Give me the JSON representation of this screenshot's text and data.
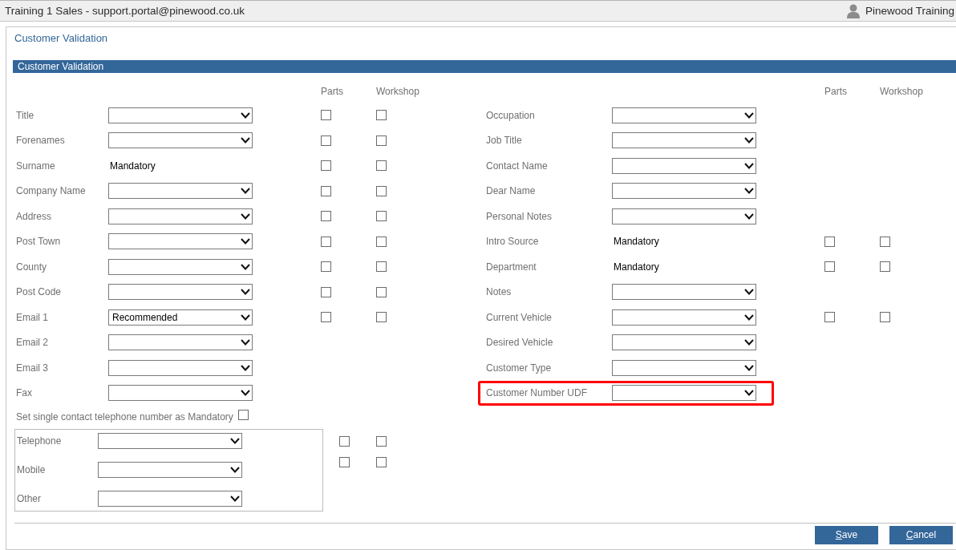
{
  "window": {
    "title": "Training 1 Sales - support.portal@pinewood.co.uk",
    "user": "Pinewood Training"
  },
  "page_title": "Customer Validation",
  "section": {
    "title": "Customer Validation",
    "left": {
      "column_headers": [
        "Parts",
        "Workshop"
      ],
      "rows": [
        {
          "label": "Title",
          "kind": "dropdown",
          "highlighted": false,
          "flags": [
            {
              "checked": false
            },
            {
              "checked": false
            }
          ]
        },
        {
          "label": "Forenames",
          "kind": "dropdown",
          "highlighted": false,
          "flags": [
            {
              "checked": false
            },
            {
              "checked": false
            }
          ]
        },
        {
          "label": "Surname",
          "kind": "fixed",
          "value": "Mandatory",
          "highlighted": false,
          "flags": [
            {
              "checked": false
            },
            {
              "checked": false
            }
          ]
        },
        {
          "label": "Company Name",
          "kind": "dropdown",
          "highlighted": false,
          "flags": [
            {
              "checked": false
            },
            {
              "checked": false
            }
          ]
        },
        {
          "label": "Address",
          "kind": "dropdown",
          "highlighted": false,
          "flags": [
            {
              "checked": false
            },
            {
              "checked": false
            }
          ]
        },
        {
          "label": "Post Town",
          "kind": "dropdown",
          "highlighted": false,
          "flags": [
            {
              "checked": false
            },
            {
              "checked": false
            }
          ]
        },
        {
          "label": "County",
          "kind": "dropdown",
          "highlighted": false,
          "flags": [
            {
              "checked": false
            },
            {
              "checked": false
            }
          ]
        },
        {
          "label": "Post Code",
          "kind": "dropdown",
          "highlighted": false,
          "flags": [
            {
              "checked": false
            },
            {
              "checked": false
            }
          ]
        },
        {
          "label": "Email 1",
          "kind": "dropdown",
          "value": "Recommended",
          "highlighted": false,
          "flags": [
            {
              "checked": false
            },
            {
              "checked": false
            }
          ]
        },
        {
          "label": "Email 2",
          "kind": "dropdown",
          "highlighted": false
        },
        {
          "label": "Email 3",
          "kind": "dropdown",
          "highlighted": false
        },
        {
          "label": "Fax",
          "kind": "dropdown",
          "highlighted": false
        }
      ]
    },
    "right": {
      "column_headers": [
        "Parts",
        "Workshop"
      ],
      "rows": [
        {
          "label": "Occupation",
          "kind": "dropdown",
          "highlighted": false
        },
        {
          "label": "Job Title",
          "kind": "dropdown",
          "highlighted": false
        },
        {
          "label": "Contact Name",
          "kind": "dropdown",
          "highlighted": false
        },
        {
          "label": "Dear Name",
          "kind": "dropdown",
          "highlighted": false
        },
        {
          "label": "Personal Notes",
          "kind": "dropdown",
          "highlighted": false
        },
        {
          "label": "Intro Source",
          "kind": "fixed",
          "value": "Mandatory",
          "highlighted": false,
          "flags": [
            {
              "checked": false
            },
            {
              "checked": false
            }
          ]
        },
        {
          "label": "Department",
          "kind": "fixed",
          "value": "Mandatory",
          "highlighted": false,
          "flags": [
            {
              "checked": false
            },
            {
              "checked": false
            }
          ]
        },
        {
          "label": "Notes",
          "kind": "dropdown",
          "highlighted": false
        },
        {
          "label": "Current Vehicle",
          "kind": "dropdown",
          "highlighted": false,
          "flags": [
            {
              "checked": false
            },
            {
              "checked": false
            }
          ]
        },
        {
          "label": "Desired Vehicle",
          "kind": "dropdown",
          "highlighted": false
        },
        {
          "label": "Customer Type",
          "kind": "dropdown",
          "highlighted": false
        },
        {
          "label": "Customer Number UDF",
          "kind": "dropdown",
          "highlighted": true
        }
      ]
    },
    "telephone": {
      "label": "Set single contact telephone number as Mandatory",
      "checked": false,
      "rows": [
        {
          "label": "Telephone",
          "kind": "dropdown",
          "flags": [
            {
              "checked": false
            },
            {
              "checked": false
            }
          ]
        },
        {
          "label": "Mobile",
          "kind": "dropdown",
          "flags": [
            {
              "checked": false
            },
            {
              "checked": false
            }
          ]
        },
        {
          "label": "Other",
          "kind": "dropdown"
        }
      ]
    }
  },
  "buttons": [
    "Save",
    "Cancel"
  ]
}
